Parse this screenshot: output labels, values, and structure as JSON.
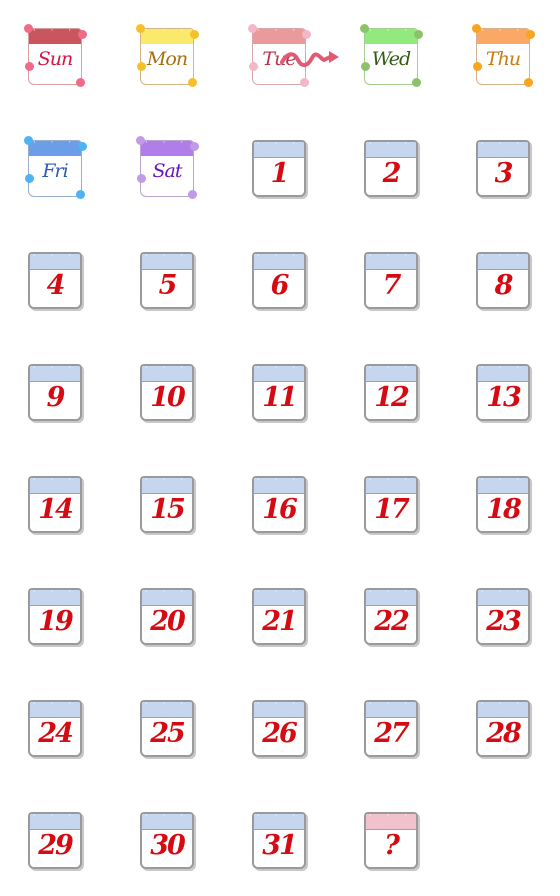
{
  "cells": [
    {
      "type": "day",
      "label": "Sun",
      "header": "#c9565f",
      "text": "#d41746",
      "border": "#d9a0a0",
      "deco": "#f06b88",
      "icon": "heart-icon"
    },
    {
      "type": "day",
      "label": "Mon",
      "header": "#fbe96b",
      "text": "#a8700e",
      "border": "#d4b48a",
      "deco": "#f5c12a",
      "icon": "star-icon"
    },
    {
      "type": "day",
      "label": "Tue",
      "header": "#eb9a9c",
      "text": "#b6354e",
      "border": "#d9a9a9",
      "deco": "#f2b8c8",
      "icon": "flower-icon"
    },
    {
      "type": "day",
      "label": "Wed",
      "header": "#92ea7f",
      "text": "#325c16",
      "border": "#a6cf94",
      "deco": "#8cc36a",
      "icon": "leaf-icon"
    },
    {
      "type": "day",
      "label": "Thu",
      "header": "#fba866",
      "text": "#c77d14",
      "border": "#d7b28e",
      "deco": "#f9a51f",
      "icon": "orange-icon"
    },
    {
      "type": "day",
      "label": "Fri",
      "header": "#6c9ee8",
      "text": "#2f5cae",
      "border": "#98aecd",
      "deco": "#4db3f3",
      "icon": "bubble-icon"
    },
    {
      "type": "day",
      "label": "Sat",
      "header": "#b07ee8",
      "text": "#6a12c4",
      "border": "#b9a3cf",
      "deco": "#c19be6",
      "icon": "flower-icon"
    },
    {
      "type": "arrow",
      "label": "",
      "color": "#df5a72",
      "icon": "squiggle-arrow-icon"
    },
    {
      "type": "num",
      "label": "1"
    },
    {
      "type": "num",
      "label": "2"
    },
    {
      "type": "num",
      "label": "3"
    },
    {
      "type": "num",
      "label": "4"
    },
    {
      "type": "num",
      "label": "5"
    },
    {
      "type": "num",
      "label": "6"
    },
    {
      "type": "num",
      "label": "7"
    },
    {
      "type": "num",
      "label": "8"
    },
    {
      "type": "num",
      "label": "9"
    },
    {
      "type": "num",
      "label": "10"
    },
    {
      "type": "num",
      "label": "11"
    },
    {
      "type": "num",
      "label": "12"
    },
    {
      "type": "num",
      "label": "13"
    },
    {
      "type": "num",
      "label": "14"
    },
    {
      "type": "num",
      "label": "15"
    },
    {
      "type": "num",
      "label": "16"
    },
    {
      "type": "num",
      "label": "17"
    },
    {
      "type": "num",
      "label": "18"
    },
    {
      "type": "num",
      "label": "19"
    },
    {
      "type": "num",
      "label": "20"
    },
    {
      "type": "num",
      "label": "21"
    },
    {
      "type": "num",
      "label": "22"
    },
    {
      "type": "num",
      "label": "23"
    },
    {
      "type": "num",
      "label": "24"
    },
    {
      "type": "num",
      "label": "25"
    },
    {
      "type": "num",
      "label": "26"
    },
    {
      "type": "num",
      "label": "27"
    },
    {
      "type": "num",
      "label": "28"
    },
    {
      "type": "num",
      "label": "29"
    },
    {
      "type": "num",
      "label": "30"
    },
    {
      "type": "num",
      "label": "31"
    },
    {
      "type": "num",
      "label": "?",
      "header": "#f2c2cc"
    }
  ],
  "colors": {
    "number_header": "#c6d6ef",
    "number_text": "#d40b12"
  }
}
